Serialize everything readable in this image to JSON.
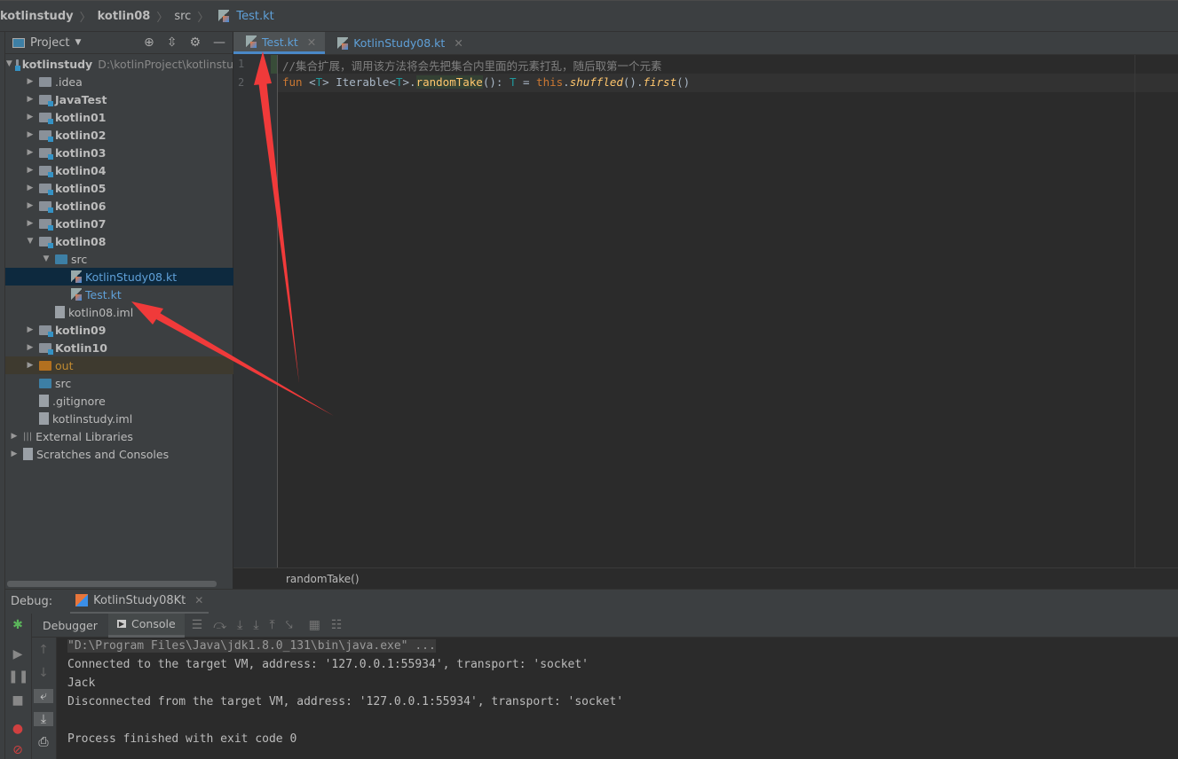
{
  "breadcrumb": [
    "kotlinstudy",
    "kotlin08",
    "src",
    "Test.kt"
  ],
  "project": {
    "label": "Project",
    "root_path": "D:\\kotlinProject\\kotlinstu"
  },
  "tree": [
    {
      "label": "kotlinstudy",
      "level": 0,
      "type": "module",
      "open": true,
      "bold": true
    },
    {
      "label": ".idea",
      "level": 1,
      "type": "folder"
    },
    {
      "label": "JavaTest",
      "level": 1,
      "type": "module",
      "bold": true
    },
    {
      "label": "kotlin01",
      "level": 1,
      "type": "module",
      "bold": true
    },
    {
      "label": "kotlin02",
      "level": 1,
      "type": "module",
      "bold": true
    },
    {
      "label": "kotlin03",
      "level": 1,
      "type": "module",
      "bold": true
    },
    {
      "label": "kotlin04",
      "level": 1,
      "type": "module",
      "bold": true
    },
    {
      "label": "kotlin05",
      "level": 1,
      "type": "module",
      "bold": true
    },
    {
      "label": "kotlin06",
      "level": 1,
      "type": "module",
      "bold": true
    },
    {
      "label": "kotlin07",
      "level": 1,
      "type": "module",
      "bold": true
    },
    {
      "label": "kotlin08",
      "level": 1,
      "type": "module",
      "open": true,
      "bold": true
    },
    {
      "label": "src",
      "level": 2,
      "type": "src",
      "open": true
    },
    {
      "label": "KotlinStudy08.kt",
      "level": 3,
      "type": "kt",
      "selected": true
    },
    {
      "label": "Test.kt",
      "level": 3,
      "type": "kt"
    },
    {
      "label": "kotlin08.iml",
      "level": 2,
      "type": "file",
      "leaf": true
    },
    {
      "label": "kotlin09",
      "level": 1,
      "type": "module",
      "bold": true
    },
    {
      "label": "Kotlin10",
      "level": 1,
      "type": "module",
      "bold": true
    },
    {
      "label": "out",
      "level": 1,
      "type": "out"
    },
    {
      "label": "src",
      "level": 1,
      "type": "src",
      "leaf": true
    },
    {
      "label": ".gitignore",
      "level": 1,
      "type": "file",
      "leaf": true
    },
    {
      "label": "kotlinstudy.iml",
      "level": 1,
      "type": "file",
      "leaf": true
    },
    {
      "label": "External Libraries",
      "level": 0,
      "type": "lib"
    },
    {
      "label": "Scratches and Consoles",
      "level": 0,
      "type": "scratch"
    }
  ],
  "tabs": [
    {
      "label": "Test.kt",
      "active": true
    },
    {
      "label": "KotlinStudy08.kt"
    }
  ],
  "editor": {
    "line_numbers": [
      "1",
      "2"
    ],
    "comment": "//集合扩展，调用该方法将会先把集合内里面的元素打乱，随后取第一个元素",
    "code_tokens": [
      [
        "fun ",
        "kw"
      ],
      [
        "<",
        "p"
      ],
      [
        "T",
        "tp"
      ],
      [
        "> Iterable<",
        "p"
      ],
      [
        "T",
        "tp"
      ],
      [
        ">.",
        "p"
      ],
      [
        "randomTake",
        "fn"
      ],
      [
        "(): ",
        "p"
      ],
      [
        "T",
        "tp"
      ],
      [
        " = ",
        "p"
      ],
      [
        "this",
        "kw"
      ],
      [
        ".",
        "p"
      ],
      [
        "shuffled",
        "it"
      ],
      [
        "().",
        "p"
      ],
      [
        "first",
        "it"
      ],
      [
        "()",
        "p"
      ]
    ],
    "breadcrumb": "randomTake()"
  },
  "debug": {
    "label": "Debug:",
    "session": "KotlinStudy08Kt",
    "tabs": [
      "Debugger",
      "Console"
    ],
    "active_tab": "Console",
    "console": [
      "\"D:\\Program Files\\Java\\jdk1.8.0_131\\bin\\java.exe\" ...",
      "Connected to the target VM, address: '127.0.0.1:55934', transport: 'socket'",
      "Jack",
      "Disconnected from the target VM, address: '127.0.0.1:55934', transport: 'socket'",
      "",
      "Process finished with exit code 0"
    ]
  },
  "colors": {
    "annotation_arrow": "#f03a3a",
    "accent": "#4a88c7"
  }
}
